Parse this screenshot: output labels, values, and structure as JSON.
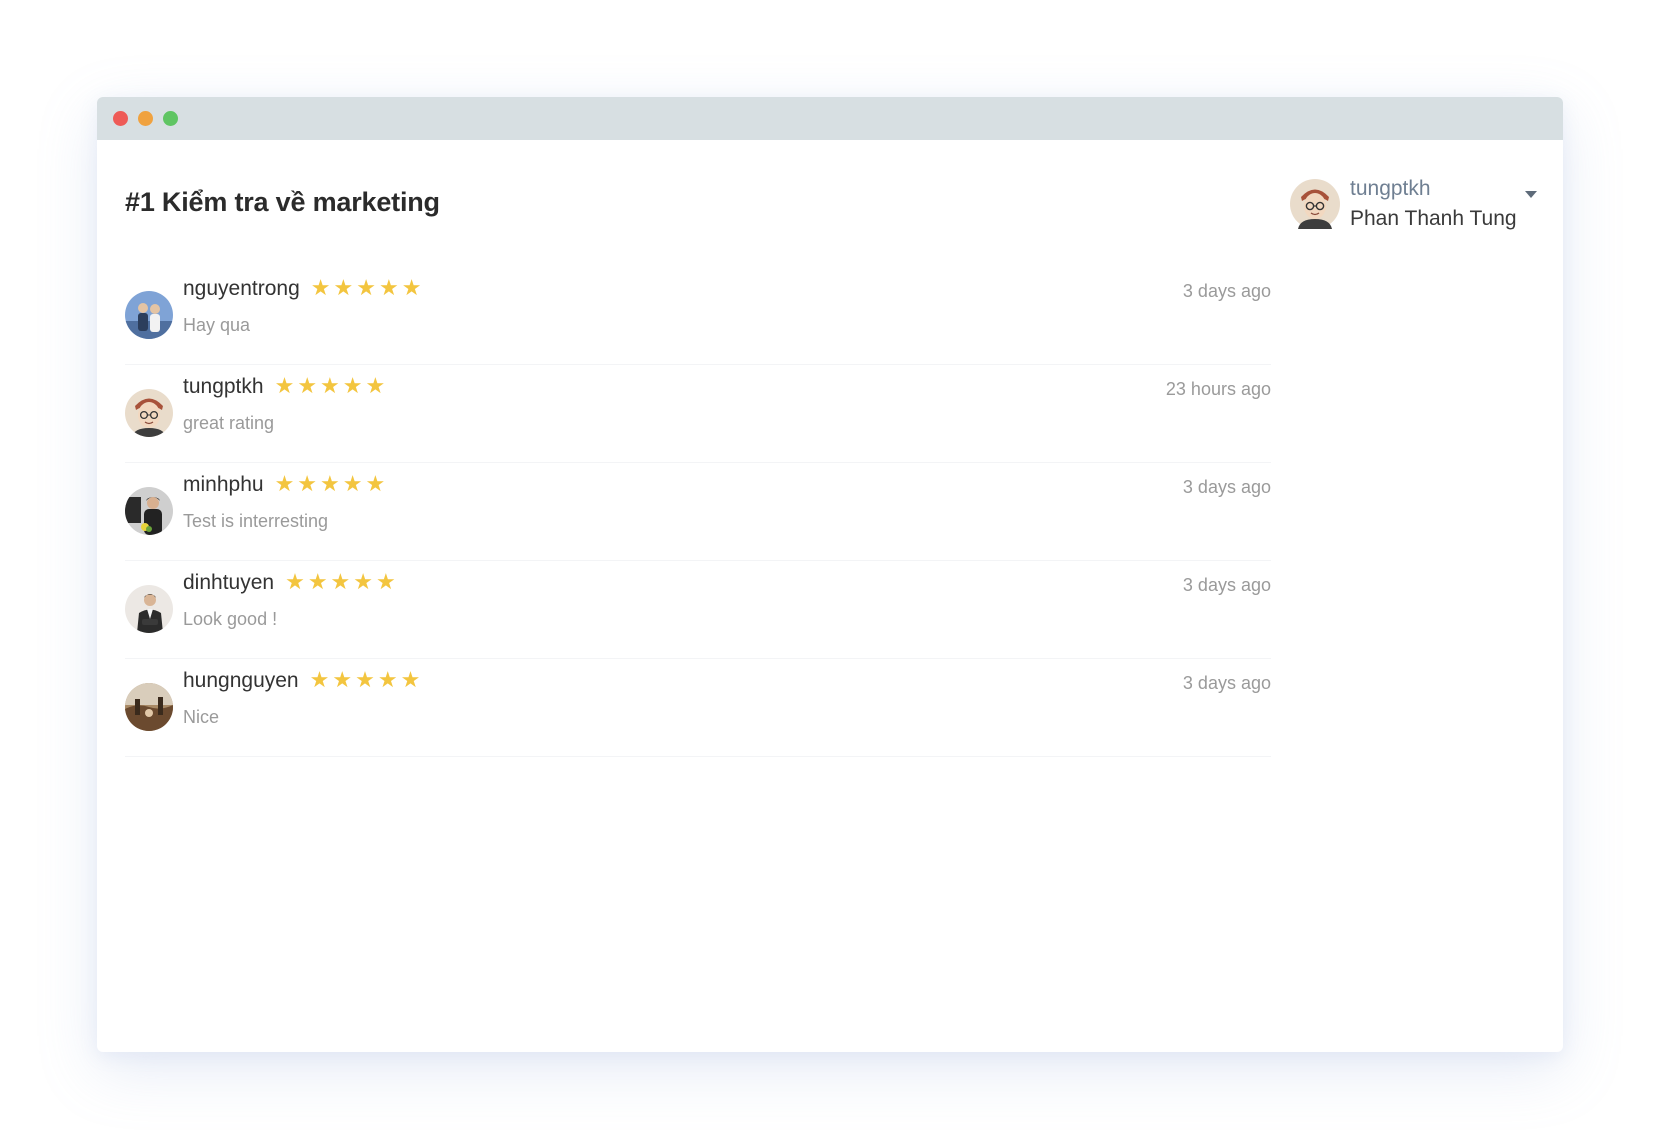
{
  "window": {
    "controls": [
      "close",
      "minimize",
      "maximize"
    ],
    "colors": {
      "close": "#ee5b57",
      "minimize": "#f0a23f",
      "maximize": "#5fc563",
      "titlebar": "#d7dfe2"
    }
  },
  "page": {
    "title": "#1 Kiểm tra về marketing"
  },
  "user_menu": {
    "username": "tungptkh",
    "full_name": "Phan Thanh Tung",
    "icon": "chevron-down-icon"
  },
  "reviews": [
    {
      "name": "nguyentrong",
      "rating": 5,
      "comment": "Hay qua",
      "time": "3 days ago",
      "avatar_bg": "#5b7fb8"
    },
    {
      "name": "tungptkh",
      "rating": 5,
      "comment": "great rating",
      "time": "23 hours ago",
      "avatar_bg": "#e9dccb"
    },
    {
      "name": "minhphu",
      "rating": 5,
      "comment": "Test is interresting",
      "time": "3 days ago",
      "avatar_bg": "#4a4a4a"
    },
    {
      "name": "dinhtuyen",
      "rating": 5,
      "comment": "Look good !",
      "time": "3 days ago",
      "avatar_bg": "#ece8e4"
    },
    {
      "name": "hungnguyen",
      "rating": 5,
      "comment": "Nice",
      "time": "3 days ago",
      "avatar_bg": "#8a6a4a"
    }
  ],
  "accent": {
    "star": "#f3c53f"
  }
}
